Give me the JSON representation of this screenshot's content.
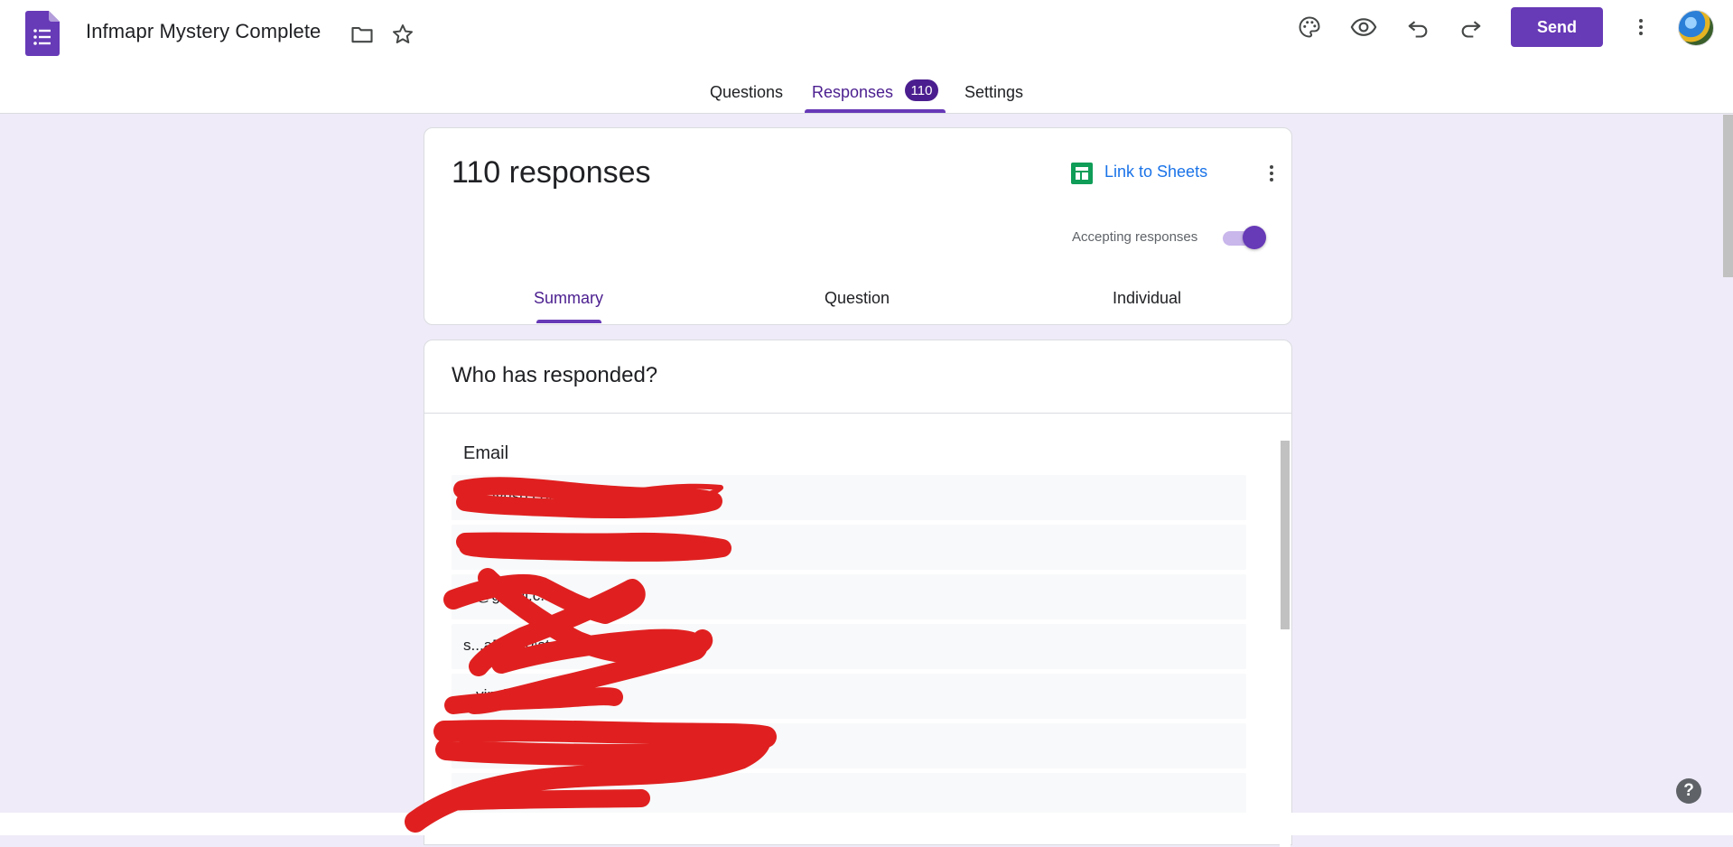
{
  "header": {
    "title": "Infmapr Mystery Complete",
    "send_label": "Send",
    "icons": [
      "forms-logo-icon",
      "folder-icon",
      "star-icon",
      "palette-icon",
      "preview-eye-icon",
      "undo-icon",
      "redo-icon",
      "more-vert-icon",
      "avatar"
    ]
  },
  "tabs": [
    {
      "label": "Questions"
    },
    {
      "label": "Responses",
      "active": true,
      "badge": "110"
    },
    {
      "label": "Settings"
    }
  ],
  "summary_card": {
    "count_text": "110 responses",
    "link_sheets": "Link to Sheets",
    "accepting_label": "Accepting responses",
    "accepting_on": true,
    "subtabs": [
      {
        "label": "Summary",
        "active": true
      },
      {
        "label": "Question"
      },
      {
        "label": "Individual"
      }
    ]
  },
  "responders_card": {
    "title": "Who has responded?",
    "column_header": "Email",
    "rows": [
      "...wayusd.com",
      "...",
      "...@gmail.c...",
      "s...a52...@stu.p...s...m",
      "...vinch...il.c...",
      "...y...",
      "..."
    ]
  },
  "colors": {
    "accent": "#673ab7",
    "accent_dark": "#4b1e8f",
    "background": "#efebf8",
    "link": "#1a73e8",
    "sheets_green": "#0f9d58",
    "redaction": "#e02020"
  }
}
